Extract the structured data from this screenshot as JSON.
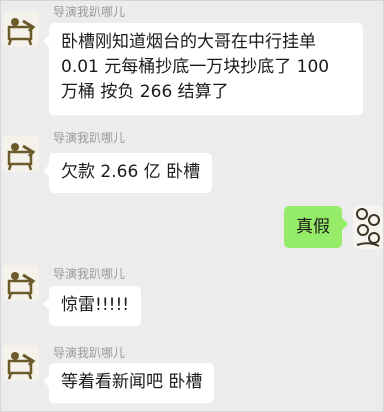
{
  "messages": [
    {
      "sender": "导演我趴哪儿",
      "lines": [
        "卧槽刚知道烟台的大哥在中行挂单",
        "0.01 元每桶抄底一万块抄底了 100",
        "万桶 按负 266 结算了"
      ]
    },
    {
      "sender": "导演我趴哪儿",
      "text": "欠款 2.66 亿 卧槽"
    },
    {
      "self": true,
      "text": "真假"
    },
    {
      "sender": "导演我趴哪儿",
      "text": "惊雷!!!!!"
    },
    {
      "sender": "导演我趴哪儿",
      "text": "等着看新闻吧 卧槽"
    }
  ],
  "colors": {
    "background": "#ececec",
    "incoming_bubble": "#ffffff",
    "outgoing_bubble": "#95ec69",
    "sender_name": "#9a9a9a"
  },
  "icons": {
    "incoming_avatar": "cartoon-figure-avatar-icon",
    "outgoing_avatar": "pattern-avatar-icon"
  }
}
